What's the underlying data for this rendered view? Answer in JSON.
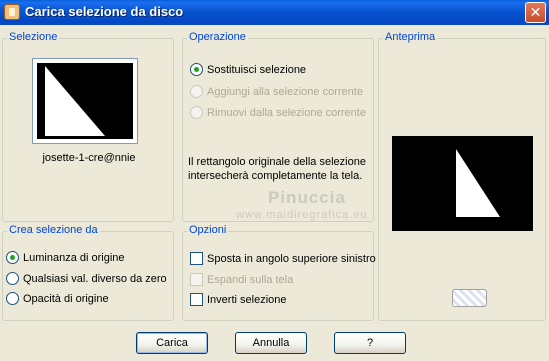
{
  "window": {
    "title": "Carica selezione da disco",
    "close_glyph": "✕"
  },
  "selezione": {
    "legend": "Selezione",
    "thumbnail_name": "josette-1-cre@nnie"
  },
  "operazione": {
    "legend": "Operazione",
    "options": [
      {
        "label": "Sostituisci selezione",
        "checked": true,
        "enabled": true
      },
      {
        "label": "Aggiungi alla selezione corrente",
        "checked": false,
        "enabled": false
      },
      {
        "label": "Rimuovi dalla selezione corrente",
        "checked": false,
        "enabled": false
      }
    ],
    "info": "Il rettangolo originale della selezione intersecherà completamente la tela."
  },
  "anteprima": {
    "legend": "Anteprima"
  },
  "crea_selezione": {
    "legend": "Crea selezione da",
    "options": [
      {
        "label": "Luminanza di origine",
        "checked": true
      },
      {
        "label": "Qualsiasi val. diverso da zero",
        "checked": false
      },
      {
        "label": "Opacità di origine",
        "checked": false
      }
    ]
  },
  "opzioni": {
    "legend": "Opzioni",
    "checks": [
      {
        "label": "Sposta in angolo superiore sinistro",
        "checked": false,
        "enabled": true
      },
      {
        "label": "Espandi sulla tela",
        "checked": false,
        "enabled": false
      },
      {
        "label": "Inverti selezione",
        "checked": false,
        "enabled": true
      }
    ]
  },
  "watermark": {
    "line1": "Pinuccia",
    "line2": "www.maidiregrafica.eu"
  },
  "buttons": {
    "load": "Carica",
    "cancel": "Annulla",
    "help": "?"
  }
}
